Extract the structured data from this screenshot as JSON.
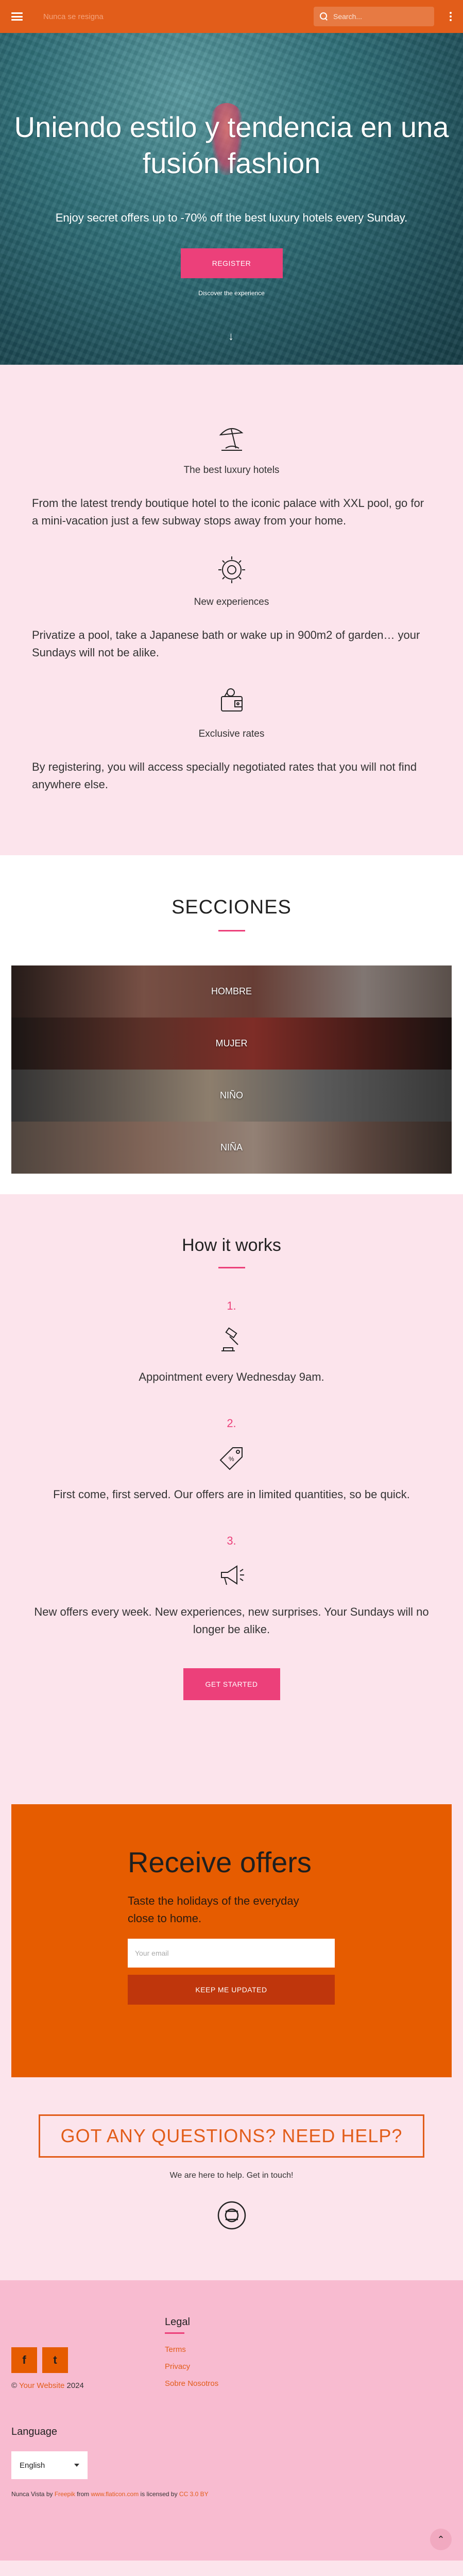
{
  "header": {
    "brand": "Nunca se resigna",
    "search_placeholder": "Search..."
  },
  "hero": {
    "title": "Uniendo estilo y tendencia en una fusión fashion",
    "lead": "Enjoy secret offers up to -70% off the best luxury hotels every Sunday.",
    "register_label": "REGISTER",
    "discover_label": "Discover the experience"
  },
  "features": [
    {
      "icon": "beach-umbrella-icon",
      "title": "The best luxury hotels",
      "text": "From the latest trendy boutique hotel to the iconic palace with XXL pool, go for a mini-vacation just a few subway stops away from your home."
    },
    {
      "icon": "sun-badge-icon",
      "title": "New experiences",
      "text": "Privatize a pool, take a Japanese bath or wake up in 900m2 of garden… your Sundays will not be alike."
    },
    {
      "icon": "wallet-icon",
      "title": "Exclusive rates",
      "text": "By registering, you will access specially negotiated rates that you will not find anywhere else."
    }
  ],
  "sections": {
    "title": "SECCIONES",
    "items": [
      "HOMBRE",
      "MUJER",
      "NIÑO",
      "NIÑA"
    ]
  },
  "how": {
    "title": "How it works",
    "steps": [
      {
        "num": "1.",
        "icon": "gavel-icon",
        "text": "Appointment every Wednesday 9am."
      },
      {
        "num": "2.",
        "icon": "price-tag-icon",
        "text": "First come, first served. Our offers are in limited quantities, so be quick."
      },
      {
        "num": "3.",
        "icon": "megaphone-icon",
        "text": "New offers every week. New experiences, new surprises. Your Sundays will no longer be alike."
      }
    ],
    "cta_label": "GET STARTED"
  },
  "offers": {
    "title": "Receive offers",
    "subtitle": "Taste the holidays of the everyday close to home.",
    "email_placeholder": "Your email",
    "button_label": "KEEP ME UPDATED"
  },
  "questions": {
    "title": "GOT ANY QUESTIONS? NEED HELP?",
    "text": "We are here to help. Get in touch!"
  },
  "footer": {
    "copyright_prefix": "© ",
    "copyright_link": "Your Website",
    "copyright_year": " 2024",
    "legal_title": "Legal",
    "legal_links": [
      "Terms",
      "Privacy",
      "Sobre Nosotros"
    ],
    "language_title": "Language",
    "language_value": "English",
    "credits_1": "Nunca Vista by ",
    "credits_link_1": "Freepik",
    "credits_2": " from ",
    "credits_link_2": "www.flaticon.com",
    "credits_3": " is licensed by ",
    "credits_link_3": "CC 3.0 BY"
  }
}
